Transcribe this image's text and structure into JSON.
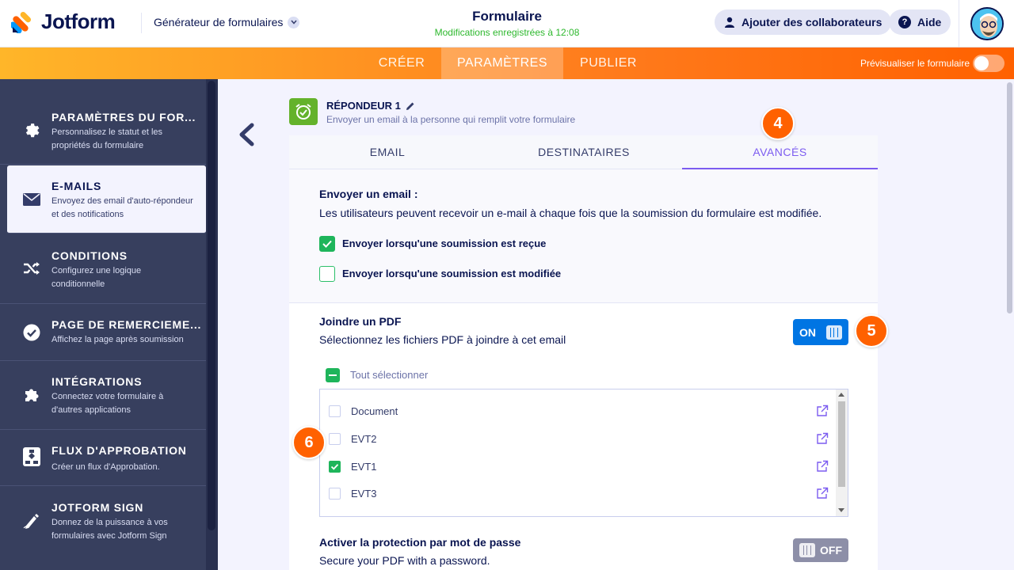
{
  "header": {
    "logo_text": "Jotform",
    "builder_label": "Générateur de formulaires",
    "form_title": "Formulaire",
    "save_status": "Modifications enregistrées à 12:08",
    "add_collaborators": "Ajouter des collaborateurs",
    "help": "Aide"
  },
  "nav": {
    "tabs": [
      "CRÉER",
      "PARAMÈTRES",
      "PUBLIER"
    ],
    "active_tab": "PARAMÈTRES",
    "preview_label": "Prévisualiser le formulaire"
  },
  "sidebar": {
    "items": [
      {
        "title": "PARAMÈTRES DU FOR...",
        "desc": "Personnalisez le statut et les propriétés du formulaire",
        "icon": "gear-icon"
      },
      {
        "title": "E-MAILS",
        "desc": "Envoyez des email d'auto-répondeur et des notifications",
        "icon": "envelope-icon"
      },
      {
        "title": "CONDITIONS",
        "desc": "Configurez une logique conditionnelle",
        "icon": "shuffle-icon"
      },
      {
        "title": "PAGE DE REMERCIEME...",
        "desc": "Affichez la page après soumission",
        "icon": "check-circle-icon"
      },
      {
        "title": "INTÉGRATIONS",
        "desc": "Connectez votre formulaire à d'autres applications",
        "icon": "puzzle-icon"
      },
      {
        "title": "FLUX D'APPROBATION",
        "desc": "Créer un flux d'Approbation.",
        "icon": "flow-icon"
      },
      {
        "title": "JOTFORM SIGN",
        "desc": "Donnez de la puissance à vos formulaires avec Jotform Sign",
        "icon": "pen-icon"
      }
    ],
    "active_index": 1
  },
  "responder": {
    "title": "RÉPONDEUR 1",
    "subtitle": "Envoyer un email à la personne qui remplit votre formulaire"
  },
  "tabs": [
    "EMAIL",
    "DESTINATAIRES",
    "AVANCÉS"
  ],
  "active_tab": "AVANCÉS",
  "send_email": {
    "label": "Envoyer un email :",
    "desc": "Les utilisateurs peuvent recevoir un e-mail à chaque fois que la soumission du formulaire est modifiée.",
    "options": [
      {
        "label": "Envoyer lorsqu'une soumission est reçue",
        "checked": true
      },
      {
        "label": "Envoyer lorsqu'une soumission est modifiée",
        "checked": false
      }
    ]
  },
  "attach_pdf": {
    "label": "Joindre un PDF",
    "desc": "Sélectionnez les fichiers PDF à joindre à cet email",
    "toggle": "ON",
    "select_all": "Tout sélectionner",
    "files": [
      {
        "name": "Document",
        "checked": false
      },
      {
        "name": "EVT2",
        "checked": false
      },
      {
        "name": "EVT1",
        "checked": true
      },
      {
        "name": "EVT3",
        "checked": false
      }
    ]
  },
  "password": {
    "label": "Activer la protection par mot de passe",
    "desc": "Secure your PDF with a password.",
    "toggle": "OFF"
  },
  "badges": [
    "4",
    "5",
    "6"
  ],
  "colors": {
    "accent_purple": "#7c5cf0",
    "orange": "#ff6100",
    "green": "#1eb55b",
    "blue_toggle": "#0075e3",
    "sidebar_bg": "#373f5e"
  }
}
